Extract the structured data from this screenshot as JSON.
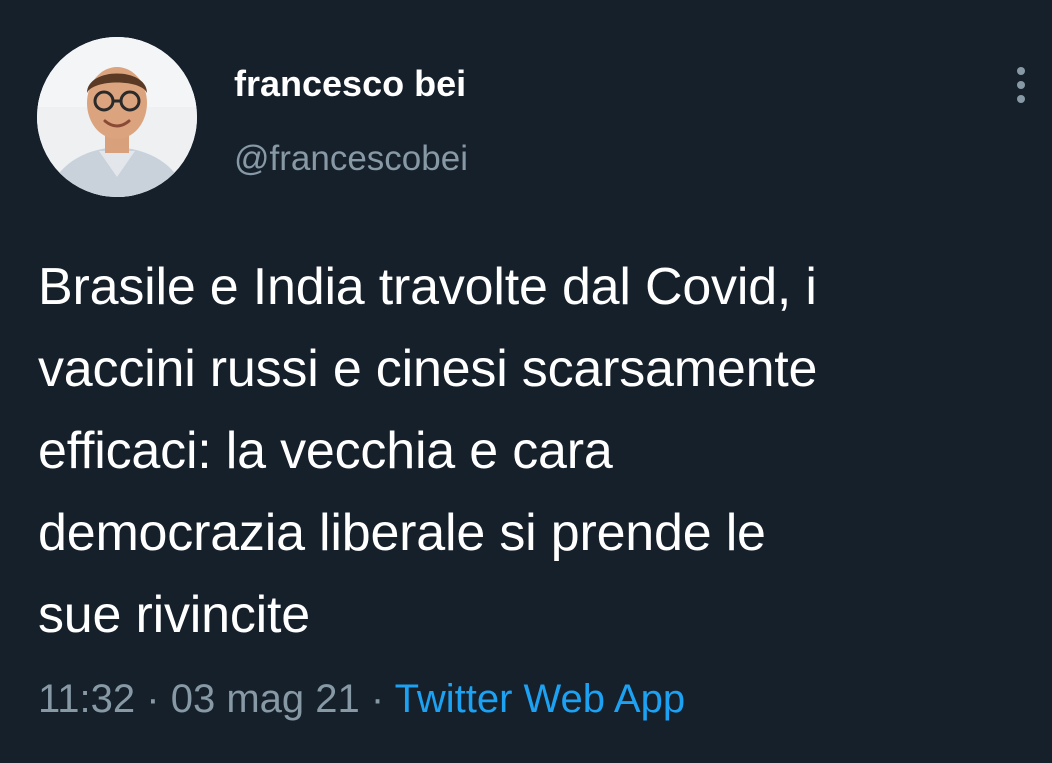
{
  "author": {
    "display_name": "francesco bei",
    "handle": "@francescobei",
    "avatar_icon": "profile-photo"
  },
  "tweet": {
    "lines": [
      "Brasile e India travolte dal Covid, i",
      "vaccini russi e cinesi scarsamente",
      "efficaci: la vecchia e cara",
      "democrazia liberale si prende le",
      "sue rivincite"
    ]
  },
  "meta": {
    "time": "11:32",
    "separator": "·",
    "date": "03 mag 21",
    "source": "Twitter Web App"
  },
  "menu": {
    "icon": "more-vertical-icon"
  },
  "colors": {
    "background": "#15202b",
    "text": "#ffffff",
    "secondary": "#8899a6",
    "accent": "#1da1f2"
  }
}
